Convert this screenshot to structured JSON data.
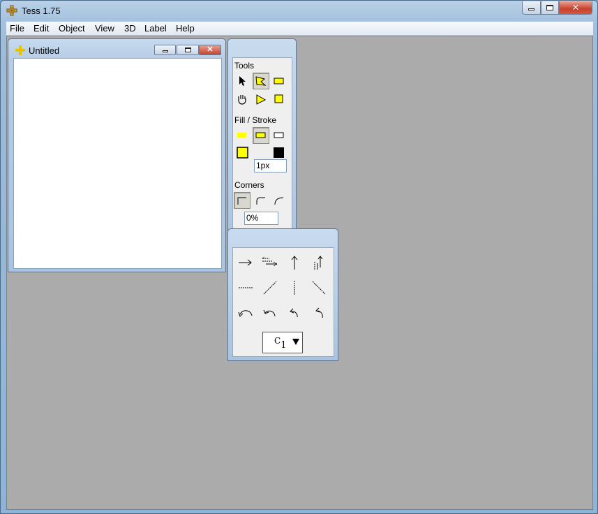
{
  "app": {
    "title": "Tess 1.75"
  },
  "menu": [
    "File",
    "Edit",
    "Object",
    "View",
    "3D",
    "Label",
    "Help"
  ],
  "document": {
    "title": "Untitled"
  },
  "tools_palette": {
    "tools_label": "Tools",
    "fill_stroke_label": "Fill / Stroke",
    "stroke_width": "1px",
    "corners_label": "Corners",
    "corner_radius": "0%"
  },
  "arrow_palette": {
    "symmetry_label": "C",
    "symmetry_subscript": "1"
  },
  "icons": {
    "tools": [
      "select-arrow-icon",
      "polygon-tool-icon",
      "rectangle-tool-icon",
      "hand-icon",
      "triangle-tool-icon",
      "square-tool-icon"
    ],
    "fill_stroke": [
      "fill-only-icon",
      "fill-and-stroke-icon",
      "stroke-only-icon",
      "fill-color-swatch-icon",
      "stroke-color-swatch-icon"
    ],
    "corners": [
      "square-corner-icon",
      "round-corner-icon",
      "curved-corner-icon"
    ]
  },
  "colors": {
    "accent_yellow": "#ffff00",
    "stroke_black": "#000000",
    "workspace_gray": "#ababab"
  }
}
